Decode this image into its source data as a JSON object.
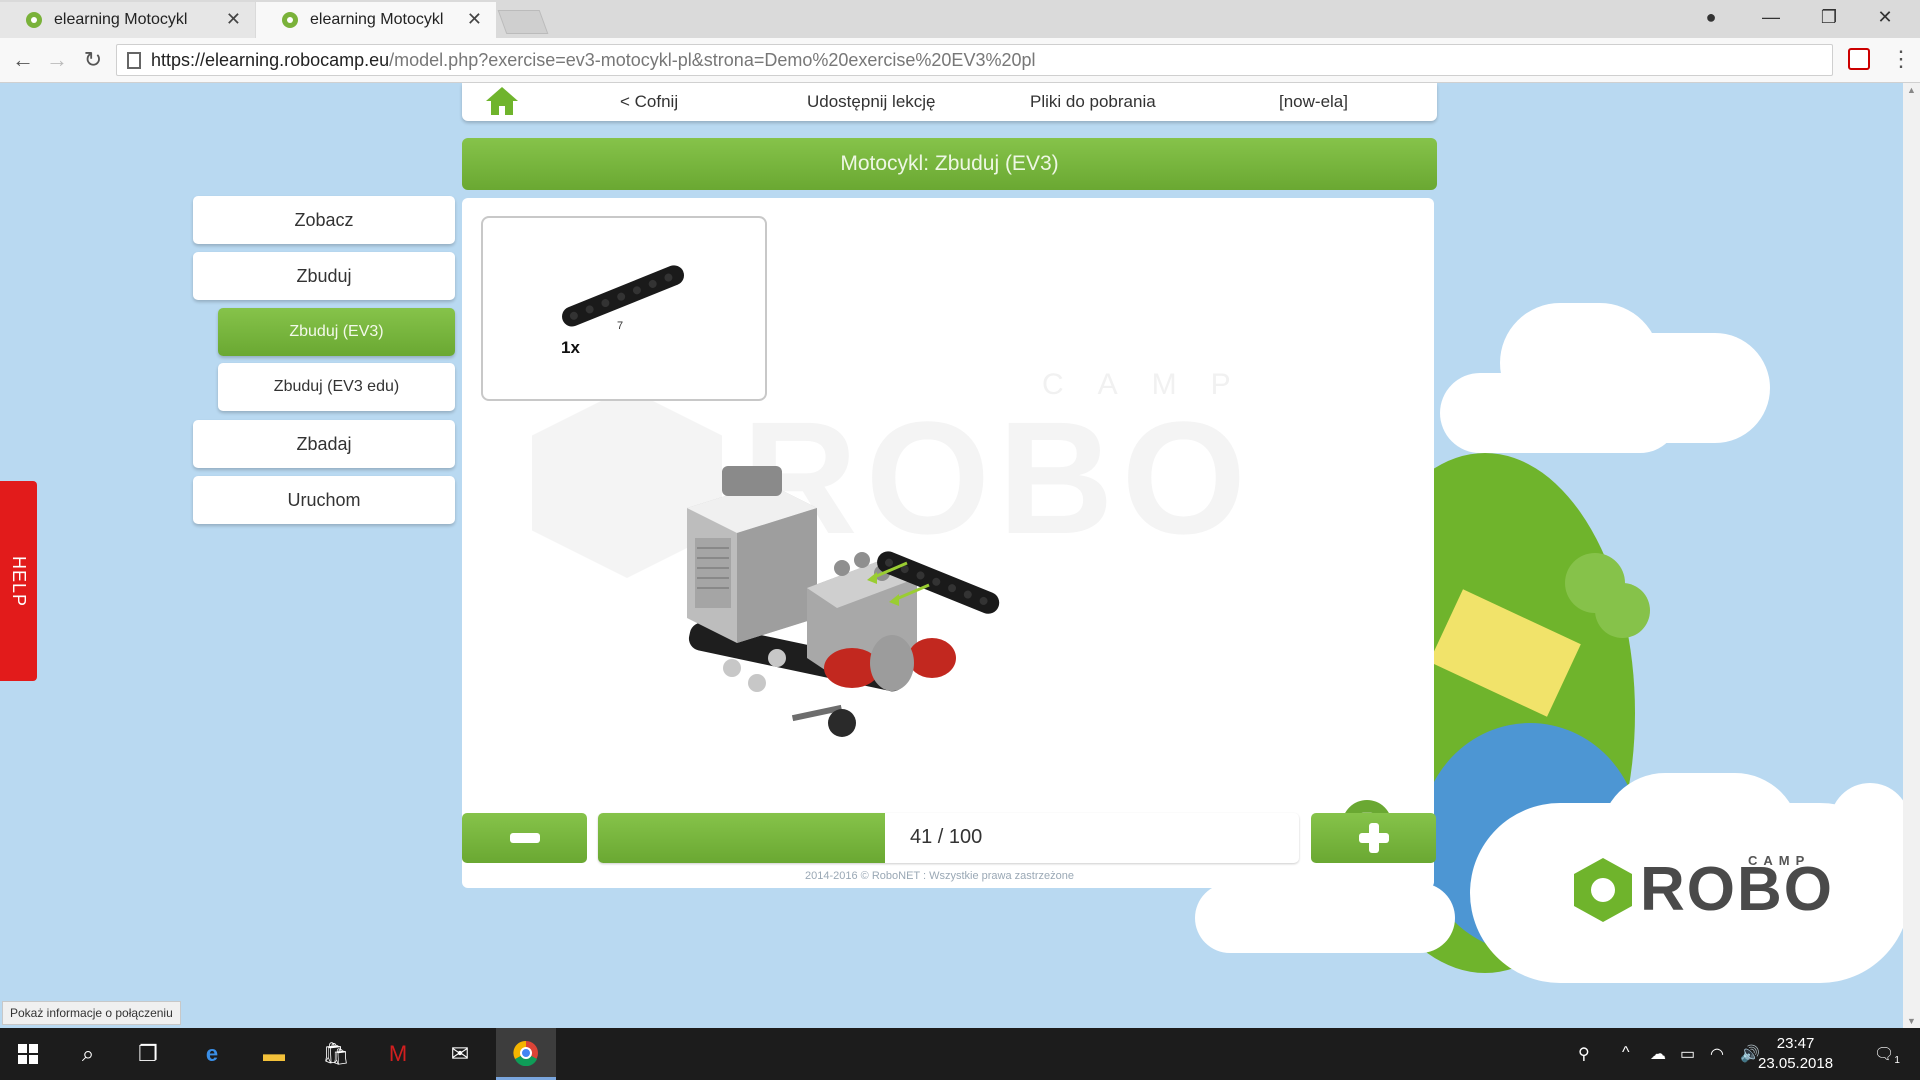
{
  "browser": {
    "tabs": [
      {
        "title": "elearning Motocykl",
        "active": false
      },
      {
        "title": "elearning Motocykl",
        "active": true
      }
    ],
    "url_host": "https://elearning.robocamp.eu",
    "url_path": "/model.php?exercise=ev3-motocykl-pl&strona=Demo%20exercise%20EV3%20pl"
  },
  "topnav": {
    "back": "< Cofnij",
    "share": "Udostępnij lekcję",
    "downloads": "Pliki do pobrania",
    "user": "[now-ela]"
  },
  "page_title": "Motocykl: Zbuduj (EV3)",
  "sidebar": {
    "items": [
      {
        "label": "Zobacz"
      },
      {
        "label": "Zbuduj"
      },
      {
        "label": "Zbuduj (EV3)",
        "active": true
      },
      {
        "label": "Zbuduj (EV3 edu)"
      },
      {
        "label": "Zbadaj"
      },
      {
        "label": "Uruchom"
      }
    ]
  },
  "help_label": "HELP",
  "parts": {
    "quantity": "1x",
    "beam_length": "7"
  },
  "watermark": {
    "text": "ROBO",
    "camp": "CAMP"
  },
  "pager": {
    "current": 41,
    "total": 100,
    "label": "41 / 100"
  },
  "copyright": "2014-2016 © RoboNET : Wszystkie prawa zastrzeżone",
  "logo": {
    "text": "ROBO",
    "camp": "CAMP"
  },
  "status_bubble": "Pokaż informacje o połączeniu",
  "taskbar": {
    "time": "23:47",
    "date": "23.05.2018",
    "notifications": "1"
  },
  "colors": {
    "accent_green": "#6fb42c",
    "sky": "#b9d9f1",
    "help_red": "#e21b1b"
  }
}
